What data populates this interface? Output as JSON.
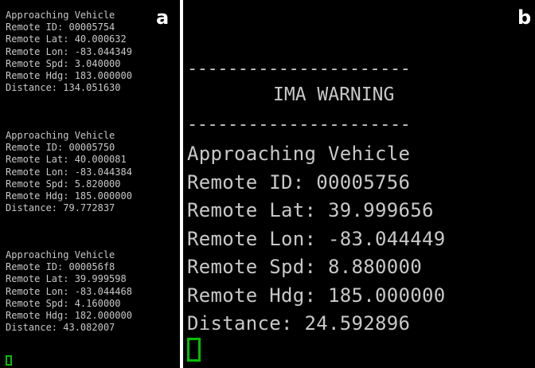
{
  "panel_a": {
    "label": "a",
    "blocks": [
      {
        "heading": "Approaching Vehicle",
        "remote_id": "Remote ID: 00005754",
        "remote_lat": "Remote Lat: 40.000632",
        "remote_lon": "Remote Lon: -83.044349",
        "remote_spd": "Remote Spd: 3.040000",
        "remote_hdg": "Remote Hdg: 183.000000",
        "distance": "Distance: 134.051630"
      },
      {
        "heading": "Approaching Vehicle",
        "remote_id": "Remote ID: 00005750",
        "remote_lat": "Remote Lat: 40.000081",
        "remote_lon": "Remote Lon: -83.044384",
        "remote_spd": "Remote Spd: 5.820000",
        "remote_hdg": "Remote Hdg: 185.000000",
        "distance": "Distance: 79.772837"
      },
      {
        "heading": "Approaching Vehicle",
        "remote_id": "Remote ID: 000056f8",
        "remote_lat": "Remote Lat: 39.999598",
        "remote_lon": "Remote Lon: -83.044468",
        "remote_spd": "Remote Spd: 4.160000",
        "remote_hdg": "Remote Hdg: 182.000000",
        "distance": "Distance: 43.082007"
      }
    ]
  },
  "panel_b": {
    "label": "b",
    "separator": "----------------------",
    "title": "IMA WARNING",
    "heading": "Approaching Vehicle",
    "remote_id": "Remote ID: 00005756",
    "remote_lat": "Remote Lat: 39.999656",
    "remote_lon": "Remote Lon: -83.044449",
    "remote_spd": "Remote Spd: 8.880000",
    "remote_hdg": "Remote Hdg: 185.000000",
    "distance": "Distance: 24.592896"
  },
  "colors": {
    "terminal_background": "#000000",
    "terminal_text": "#c8c8c8",
    "cursor": "#00c000"
  }
}
